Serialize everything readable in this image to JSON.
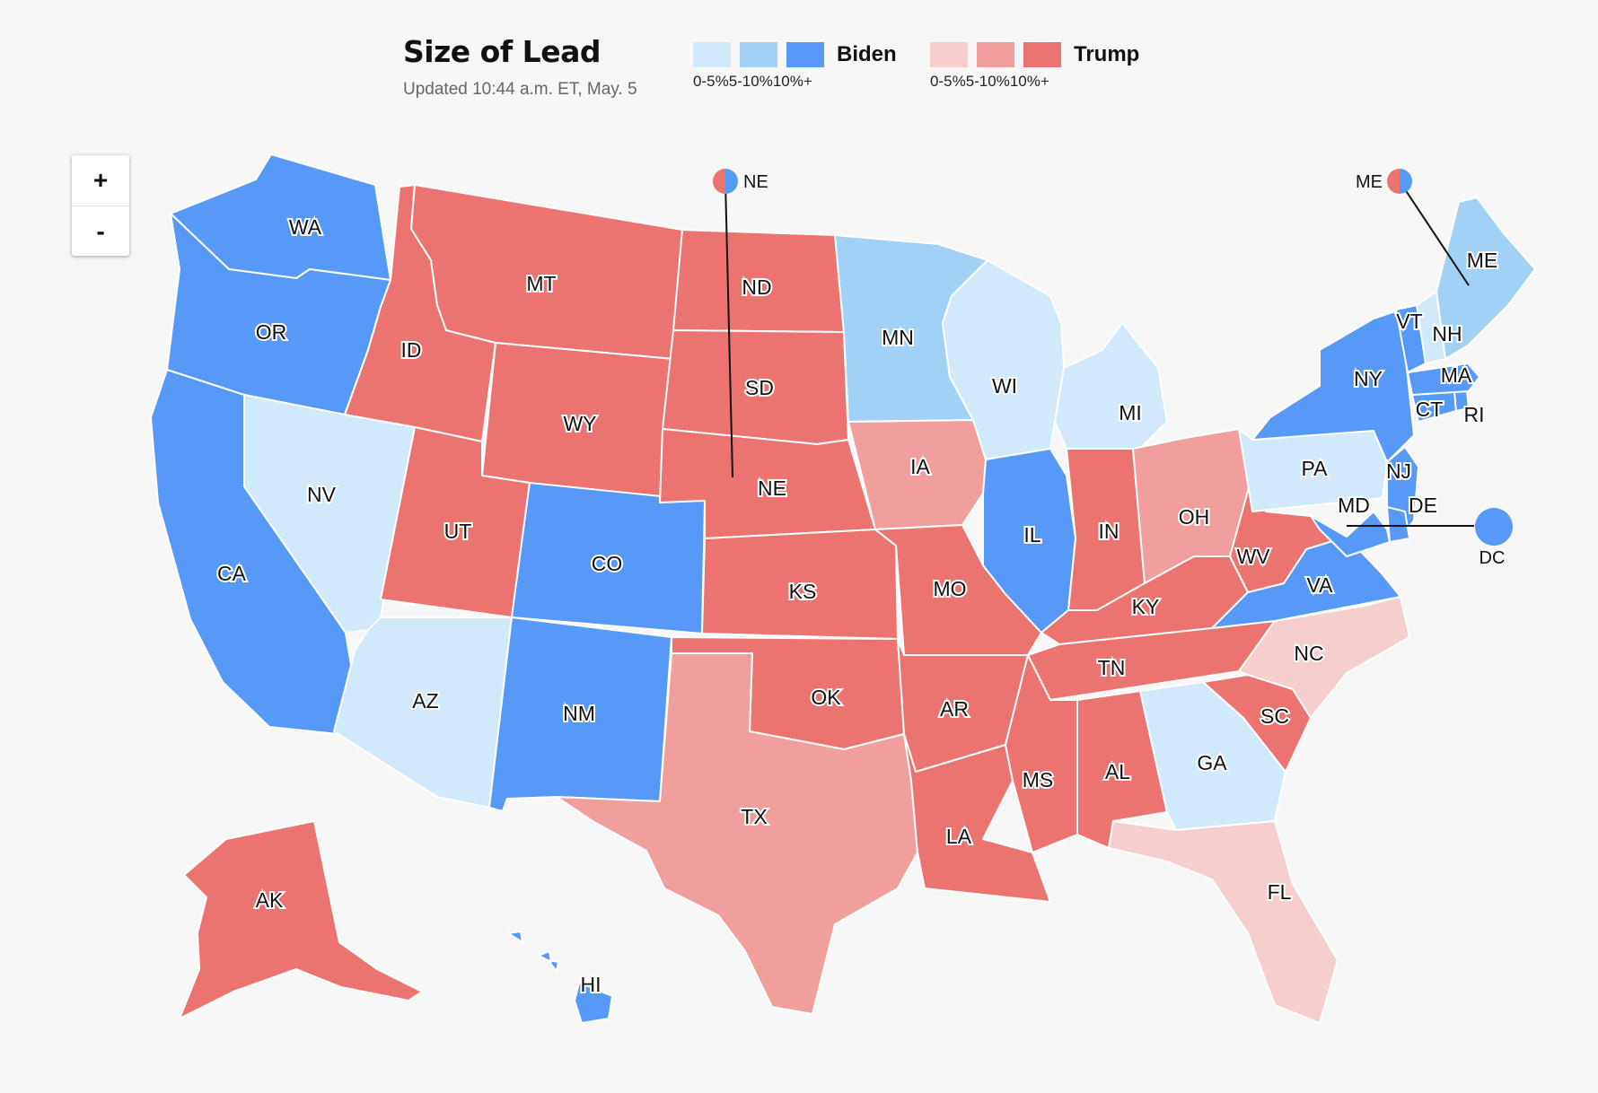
{
  "header": {
    "title": "Size of Lead",
    "updated": "Updated 10:44 a.m. ET, May. 5"
  },
  "legend": {
    "biden": {
      "name": "Biden",
      "ranges": [
        "0-5%",
        "5-10%",
        "10%+"
      ],
      "colors": [
        "#d0eafb",
        "#a1d2f6",
        "#5699f6"
      ]
    },
    "trump": {
      "name": "Trump",
      "ranges": [
        "0-5%",
        "5-10%",
        "10%+"
      ],
      "colors": [
        "#f6cece",
        "#f19f9c",
        "#ec7470"
      ]
    }
  },
  "zoom": {
    "in": "+",
    "out": "-"
  },
  "split_markers": {
    "ne": "NE",
    "me": "ME"
  },
  "dc_marker": "DC",
  "states": [
    {
      "abbr": "WA",
      "leader": "Biden",
      "level": "10%+"
    },
    {
      "abbr": "OR",
      "leader": "Biden",
      "level": "10%+"
    },
    {
      "abbr": "CA",
      "leader": "Biden",
      "level": "10%+"
    },
    {
      "abbr": "NV",
      "leader": "Biden",
      "level": "0-5%"
    },
    {
      "abbr": "ID",
      "leader": "Trump",
      "level": "10%+"
    },
    {
      "abbr": "MT",
      "leader": "Trump",
      "level": "10%+"
    },
    {
      "abbr": "WY",
      "leader": "Trump",
      "level": "10%+"
    },
    {
      "abbr": "UT",
      "leader": "Trump",
      "level": "10%+"
    },
    {
      "abbr": "AZ",
      "leader": "Biden",
      "level": "0-5%"
    },
    {
      "abbr": "CO",
      "leader": "Biden",
      "level": "10%+"
    },
    {
      "abbr": "NM",
      "leader": "Biden",
      "level": "10%+"
    },
    {
      "abbr": "ND",
      "leader": "Trump",
      "level": "10%+"
    },
    {
      "abbr": "SD",
      "leader": "Trump",
      "level": "10%+"
    },
    {
      "abbr": "NE",
      "leader": "Trump",
      "level": "10%+"
    },
    {
      "abbr": "KS",
      "leader": "Trump",
      "level": "10%+"
    },
    {
      "abbr": "OK",
      "leader": "Trump",
      "level": "10%+"
    },
    {
      "abbr": "TX",
      "leader": "Trump",
      "level": "5-10%"
    },
    {
      "abbr": "MN",
      "leader": "Biden",
      "level": "5-10%"
    },
    {
      "abbr": "IA",
      "leader": "Trump",
      "level": "5-10%"
    },
    {
      "abbr": "MO",
      "leader": "Trump",
      "level": "10%+"
    },
    {
      "abbr": "AR",
      "leader": "Trump",
      "level": "10%+"
    },
    {
      "abbr": "LA",
      "leader": "Trump",
      "level": "10%+"
    },
    {
      "abbr": "WI",
      "leader": "Biden",
      "level": "0-5%"
    },
    {
      "abbr": "IL",
      "leader": "Biden",
      "level": "10%+"
    },
    {
      "abbr": "MI",
      "leader": "Biden",
      "level": "0-5%"
    },
    {
      "abbr": "IN",
      "leader": "Trump",
      "level": "10%+"
    },
    {
      "abbr": "OH",
      "leader": "Trump",
      "level": "5-10%"
    },
    {
      "abbr": "KY",
      "leader": "Trump",
      "level": "10%+"
    },
    {
      "abbr": "TN",
      "leader": "Trump",
      "level": "10%+"
    },
    {
      "abbr": "MS",
      "leader": "Trump",
      "level": "10%+"
    },
    {
      "abbr": "AL",
      "leader": "Trump",
      "level": "10%+"
    },
    {
      "abbr": "GA",
      "leader": "Biden",
      "level": "0-5%"
    },
    {
      "abbr": "FL",
      "leader": "Trump",
      "level": "0-5%"
    },
    {
      "abbr": "SC",
      "leader": "Trump",
      "level": "10%+"
    },
    {
      "abbr": "NC",
      "leader": "Trump",
      "level": "0-5%"
    },
    {
      "abbr": "VA",
      "leader": "Biden",
      "level": "10%+"
    },
    {
      "abbr": "WV",
      "leader": "Trump",
      "level": "10%+"
    },
    {
      "abbr": "PA",
      "leader": "Biden",
      "level": "0-5%"
    },
    {
      "abbr": "NY",
      "leader": "Biden",
      "level": "10%+"
    },
    {
      "abbr": "NJ",
      "leader": "Biden",
      "level": "10%+"
    },
    {
      "abbr": "DE",
      "leader": "Biden",
      "level": "10%+"
    },
    {
      "abbr": "MD",
      "leader": "Biden",
      "level": "10%+"
    },
    {
      "abbr": "CT",
      "leader": "Biden",
      "level": "10%+"
    },
    {
      "abbr": "RI",
      "leader": "Biden",
      "level": "10%+"
    },
    {
      "abbr": "MA",
      "leader": "Biden",
      "level": "10%+"
    },
    {
      "abbr": "VT",
      "leader": "Biden",
      "level": "10%+"
    },
    {
      "abbr": "NH",
      "leader": "Biden",
      "level": "0-5%"
    },
    {
      "abbr": "ME",
      "leader": "Biden",
      "level": "5-10%"
    },
    {
      "abbr": "AK",
      "leader": "Trump",
      "level": "10%+"
    },
    {
      "abbr": "HI",
      "leader": "Biden",
      "level": "10%+"
    },
    {
      "abbr": "DC",
      "leader": "Biden",
      "level": "10%+"
    }
  ]
}
